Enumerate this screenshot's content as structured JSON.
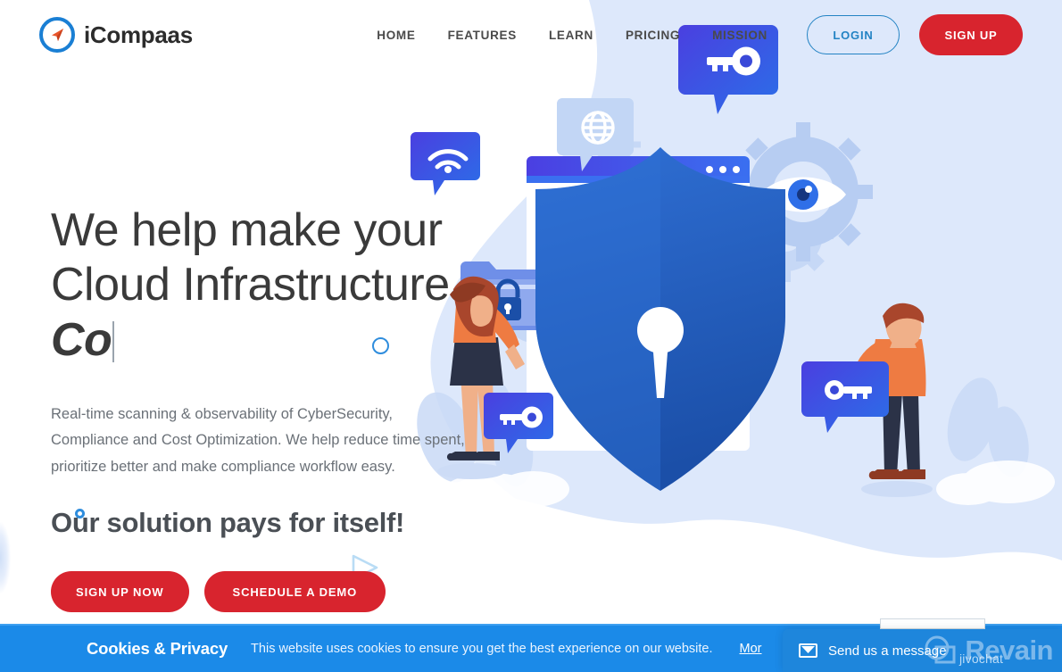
{
  "brand": {
    "name": "iCompaas",
    "logo_icon": "compass-needle-icon",
    "ring_color": "#1a7fd4",
    "needle_color": "#e8552b"
  },
  "nav": {
    "items": [
      {
        "label": "HOME"
      },
      {
        "label": "FEATURES"
      },
      {
        "label": "LEARN"
      },
      {
        "label": "PRICING"
      },
      {
        "label": "MISSION"
      }
    ],
    "login_label": "LOGIN",
    "signup_label": "SIGN UP"
  },
  "hero": {
    "headline_line1": "We help make your",
    "headline_line2": "Cloud Infrastructure",
    "headline_line3_typing": "Co",
    "subtext": "Real-time scanning & observability of CyberSecurity, Compliance and Cost Optimization. We help reduce time spent, prioritize better and make compliance workflow easy.",
    "tagline": "Our solution pays for itself!",
    "cta_primary": "SIGN UP NOW",
    "cta_secondary": "SCHEDULE A DEMO",
    "illustration": "cloud-security-shield-illustration"
  },
  "cookie_banner": {
    "title": "Cookies & Privacy",
    "message": "This website uses cookies to ensure you get the best experience on our website.",
    "more_link": "Mor",
    "background_color": "#1b8ae8"
  },
  "chat_widget": {
    "label": "Send us a message",
    "brand": "jivochat",
    "icon": "envelope-icon"
  },
  "watermark": {
    "text": "Revain"
  },
  "colors": {
    "primary_red": "#d8242e",
    "link_blue": "#2383c4",
    "hero_bg_blue": "#dde8fb",
    "heading_gray": "#3a3a3a"
  }
}
